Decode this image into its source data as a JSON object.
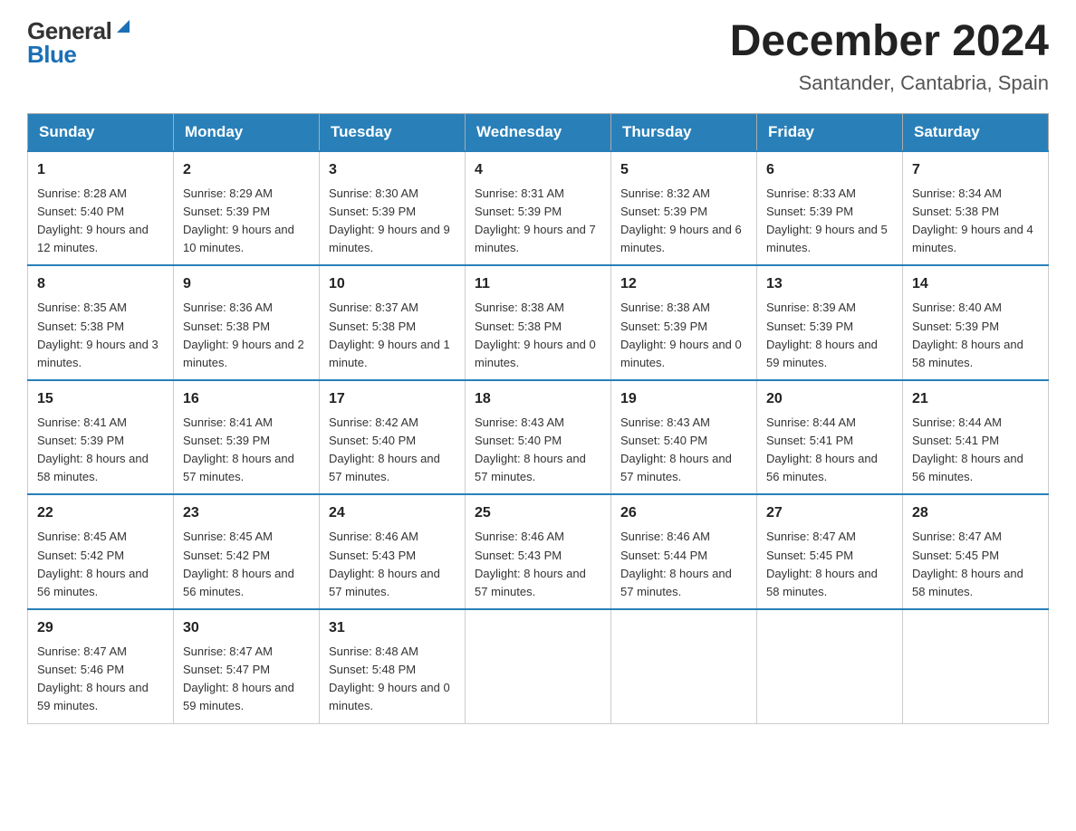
{
  "header": {
    "logo_general": "General",
    "logo_blue": "Blue",
    "month_title": "December 2024",
    "location": "Santander, Cantabria, Spain"
  },
  "days_of_week": [
    "Sunday",
    "Monday",
    "Tuesday",
    "Wednesday",
    "Thursday",
    "Friday",
    "Saturday"
  ],
  "weeks": [
    [
      {
        "day": "1",
        "sunrise": "8:28 AM",
        "sunset": "5:40 PM",
        "daylight": "9 hours and 12 minutes."
      },
      {
        "day": "2",
        "sunrise": "8:29 AM",
        "sunset": "5:39 PM",
        "daylight": "9 hours and 10 minutes."
      },
      {
        "day": "3",
        "sunrise": "8:30 AM",
        "sunset": "5:39 PM",
        "daylight": "9 hours and 9 minutes."
      },
      {
        "day": "4",
        "sunrise": "8:31 AM",
        "sunset": "5:39 PM",
        "daylight": "9 hours and 7 minutes."
      },
      {
        "day": "5",
        "sunrise": "8:32 AM",
        "sunset": "5:39 PM",
        "daylight": "9 hours and 6 minutes."
      },
      {
        "day": "6",
        "sunrise": "8:33 AM",
        "sunset": "5:39 PM",
        "daylight": "9 hours and 5 minutes."
      },
      {
        "day": "7",
        "sunrise": "8:34 AM",
        "sunset": "5:38 PM",
        "daylight": "9 hours and 4 minutes."
      }
    ],
    [
      {
        "day": "8",
        "sunrise": "8:35 AM",
        "sunset": "5:38 PM",
        "daylight": "9 hours and 3 minutes."
      },
      {
        "day": "9",
        "sunrise": "8:36 AM",
        "sunset": "5:38 PM",
        "daylight": "9 hours and 2 minutes."
      },
      {
        "day": "10",
        "sunrise": "8:37 AM",
        "sunset": "5:38 PM",
        "daylight": "9 hours and 1 minute."
      },
      {
        "day": "11",
        "sunrise": "8:38 AM",
        "sunset": "5:38 PM",
        "daylight": "9 hours and 0 minutes."
      },
      {
        "day": "12",
        "sunrise": "8:38 AM",
        "sunset": "5:39 PM",
        "daylight": "9 hours and 0 minutes."
      },
      {
        "day": "13",
        "sunrise": "8:39 AM",
        "sunset": "5:39 PM",
        "daylight": "8 hours and 59 minutes."
      },
      {
        "day": "14",
        "sunrise": "8:40 AM",
        "sunset": "5:39 PM",
        "daylight": "8 hours and 58 minutes."
      }
    ],
    [
      {
        "day": "15",
        "sunrise": "8:41 AM",
        "sunset": "5:39 PM",
        "daylight": "8 hours and 58 minutes."
      },
      {
        "day": "16",
        "sunrise": "8:41 AM",
        "sunset": "5:39 PM",
        "daylight": "8 hours and 57 minutes."
      },
      {
        "day": "17",
        "sunrise": "8:42 AM",
        "sunset": "5:40 PM",
        "daylight": "8 hours and 57 minutes."
      },
      {
        "day": "18",
        "sunrise": "8:43 AM",
        "sunset": "5:40 PM",
        "daylight": "8 hours and 57 minutes."
      },
      {
        "day": "19",
        "sunrise": "8:43 AM",
        "sunset": "5:40 PM",
        "daylight": "8 hours and 57 minutes."
      },
      {
        "day": "20",
        "sunrise": "8:44 AM",
        "sunset": "5:41 PM",
        "daylight": "8 hours and 56 minutes."
      },
      {
        "day": "21",
        "sunrise": "8:44 AM",
        "sunset": "5:41 PM",
        "daylight": "8 hours and 56 minutes."
      }
    ],
    [
      {
        "day": "22",
        "sunrise": "8:45 AM",
        "sunset": "5:42 PM",
        "daylight": "8 hours and 56 minutes."
      },
      {
        "day": "23",
        "sunrise": "8:45 AM",
        "sunset": "5:42 PM",
        "daylight": "8 hours and 56 minutes."
      },
      {
        "day": "24",
        "sunrise": "8:46 AM",
        "sunset": "5:43 PM",
        "daylight": "8 hours and 57 minutes."
      },
      {
        "day": "25",
        "sunrise": "8:46 AM",
        "sunset": "5:43 PM",
        "daylight": "8 hours and 57 minutes."
      },
      {
        "day": "26",
        "sunrise": "8:46 AM",
        "sunset": "5:44 PM",
        "daylight": "8 hours and 57 minutes."
      },
      {
        "day": "27",
        "sunrise": "8:47 AM",
        "sunset": "5:45 PM",
        "daylight": "8 hours and 58 minutes."
      },
      {
        "day": "28",
        "sunrise": "8:47 AM",
        "sunset": "5:45 PM",
        "daylight": "8 hours and 58 minutes."
      }
    ],
    [
      {
        "day": "29",
        "sunrise": "8:47 AM",
        "sunset": "5:46 PM",
        "daylight": "8 hours and 59 minutes."
      },
      {
        "day": "30",
        "sunrise": "8:47 AM",
        "sunset": "5:47 PM",
        "daylight": "8 hours and 59 minutes."
      },
      {
        "day": "31",
        "sunrise": "8:48 AM",
        "sunset": "5:48 PM",
        "daylight": "9 hours and 0 minutes."
      },
      null,
      null,
      null,
      null
    ]
  ]
}
